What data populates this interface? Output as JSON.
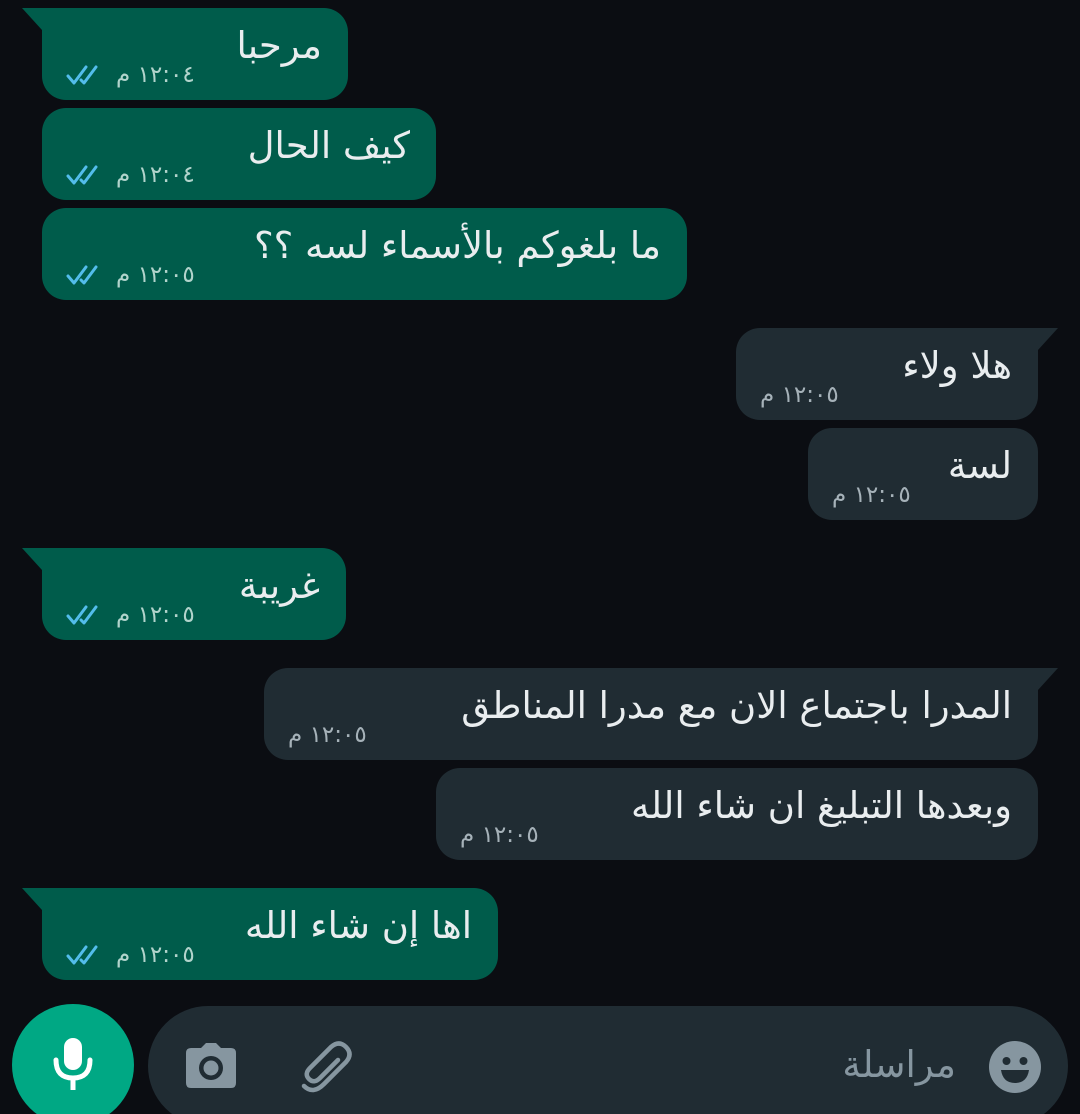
{
  "messages": [
    {
      "text": "مرحبا",
      "time": "١٢:٠٤ م",
      "direction": "outgoing",
      "status": "read"
    },
    {
      "text": "كيف الحال",
      "time": "١٢:٠٤ م",
      "direction": "outgoing",
      "status": "read"
    },
    {
      "text": "ما بلغوكم بالأسماء لسه ؟؟",
      "time": "١٢:٠٥ م",
      "direction": "outgoing",
      "status": "read"
    },
    {
      "text": "هلا ولاء",
      "time": "١٢:٠٥ م",
      "direction": "incoming"
    },
    {
      "text": "لسة",
      "time": "١٢:٠٥ م",
      "direction": "incoming"
    },
    {
      "text": "غريبة",
      "time": "١٢:٠٥ م",
      "direction": "outgoing",
      "status": "read"
    },
    {
      "text": "المدرا باجتماع الان مع مدرا المناطق",
      "time": "١٢:٠٥ م",
      "direction": "incoming"
    },
    {
      "text": "وبعدها التبليغ ان شاء الله",
      "time": "١٢:٠٥ م",
      "direction": "incoming"
    },
    {
      "text": "اها إن شاء الله",
      "time": "١٢:٠٥ م",
      "direction": "outgoing",
      "status": "read"
    }
  ],
  "composer": {
    "placeholder": "مراسلة"
  },
  "icons": {
    "mic": "microphone-icon",
    "camera": "camera-icon",
    "attach": "paperclip-icon",
    "emoji": "emoji-icon",
    "read_receipt": "double-check-icon"
  },
  "colors": {
    "background": "#0b0d12",
    "outgoing_bubble": "#005c4b",
    "incoming_bubble": "#202c33",
    "read_check": "#53bdeb",
    "accent": "#00a884"
  }
}
